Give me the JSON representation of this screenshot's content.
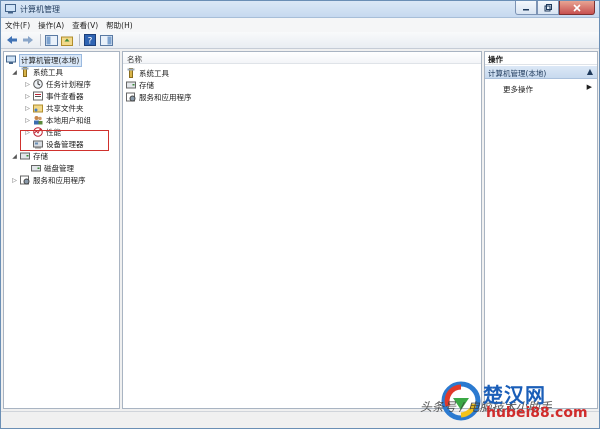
{
  "window": {
    "title": "计算机管理"
  },
  "menu": [
    "文件(F)",
    "操作(A)",
    "查看(V)",
    "帮助(H)"
  ],
  "tree": {
    "root": "计算机管理(本地)",
    "system_tools": "系统工具",
    "task_scheduler": "任务计划程序",
    "event_viewer": "事件查看器",
    "shared_folders": "共享文件夹",
    "local_users": "本地用户和组",
    "performance": "性能",
    "device_manager": "设备管理器",
    "storage": "存储",
    "disk_management": "磁盘管理",
    "services_apps": "服务和应用程序"
  },
  "center": {
    "column_name": "名称",
    "items": [
      "系统工具",
      "存储",
      "服务和应用程序"
    ]
  },
  "actions": {
    "title": "操作",
    "section": "计算机管理(本地)",
    "more": "更多操作"
  },
  "watermark": {
    "caption": "头条号 / 电脑技术小助手",
    "brand": "楚汉网",
    "url": "hubei88.com"
  },
  "colors": {
    "highlight": "#d0312d",
    "accent": "#1a5eb8"
  }
}
